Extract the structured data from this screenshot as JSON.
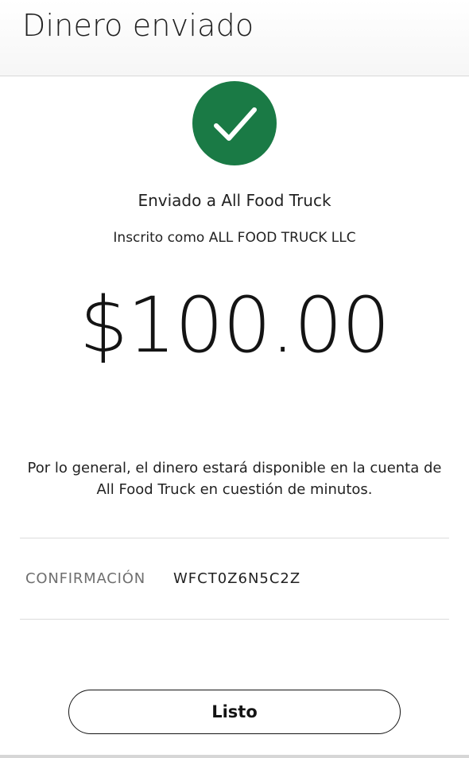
{
  "header": {
    "title": "Dinero enviado"
  },
  "status": {
    "icon": "check-circle-icon",
    "color": "#1a7a45"
  },
  "recipient": {
    "sent_to": "Enviado a All Food Truck",
    "registered_as": "Inscrito como ALL FOOD TRUCK LLC"
  },
  "transfer": {
    "amount": "$100.00",
    "availability_note": "Por lo general, el dinero estará disponible en la cuenta de All Food Truck en cuestión de minutos."
  },
  "confirmation": {
    "label": "CONFIRMACIÓN",
    "code": "WFCT0Z6N5C2Z"
  },
  "actions": {
    "done_label": "Listo"
  }
}
